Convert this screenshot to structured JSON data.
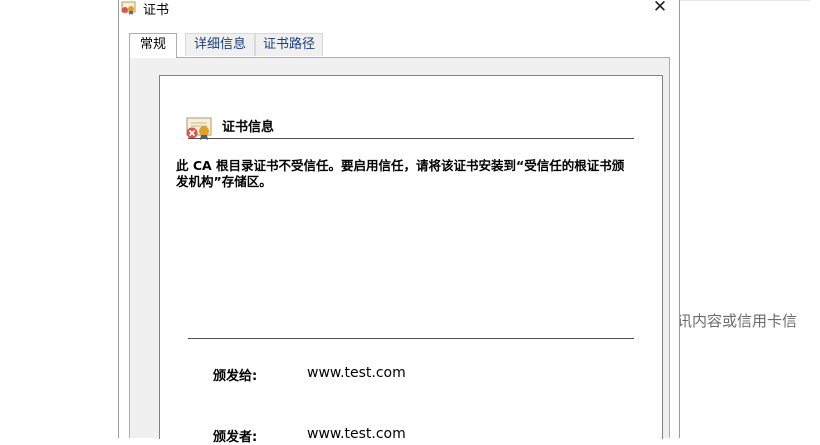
{
  "window": {
    "title": "证书",
    "close_glyph": "✕",
    "icon": "certificate-icon"
  },
  "tabs": [
    {
      "label": "常规",
      "active": true
    },
    {
      "label": "详细信息",
      "active": false
    },
    {
      "label": "证书路径",
      "active": false
    }
  ],
  "general": {
    "heading": "证书信息",
    "warning": "此 CA 根目录证书不受信任。要启用信任，请将该证书安装到“受信任的根证书颁发机构”存储区。",
    "issued_to_label": "颁发给:",
    "issued_to_value": "www.test.com",
    "issued_by_label": "颁发者:",
    "issued_by_value": "www.test.com"
  },
  "background": {
    "partial_text": "讯内容或信用卡信"
  },
  "colors": {
    "tab_text": "#1a3f7a",
    "panel_bg": "#f0f0f0",
    "error_red": "#d9534f",
    "seal_gold": "#e0a020"
  }
}
